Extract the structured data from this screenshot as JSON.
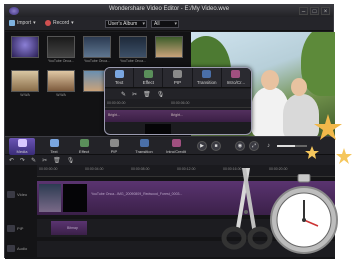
{
  "window": {
    "title": "Wondershare Video Editor - E:/My Video.wve"
  },
  "toolbar": {
    "import_label": "Import",
    "record_label": "Record",
    "album_select": "User's Album",
    "filter_select": "All"
  },
  "library": {
    "items": [
      {
        "label": ""
      },
      {
        "label": "YouTube Onca..."
      },
      {
        "label": "YouTube Onca..."
      },
      {
        "label": "YouTube Onca..."
      },
      {
        "label": ""
      },
      {
        "label": "W.WA"
      },
      {
        "label": "W.WA"
      },
      {
        "label": ""
      }
    ]
  },
  "popup": {
    "tabs": [
      {
        "label": "Text",
        "icon": "text-icon"
      },
      {
        "label": "Effect",
        "icon": "effect-icon"
      },
      {
        "label": "PIP",
        "icon": "pip-icon"
      },
      {
        "label": "Transition",
        "icon": "transition-icon"
      },
      {
        "label": "Intro/Cr...",
        "icon": "intro-credit-icon"
      }
    ],
    "ruler_times": [
      "00:00:00.00",
      "00:00:06.00"
    ],
    "clip_labels": [
      "Bright...",
      "Bright..."
    ]
  },
  "bottom_tabs": [
    {
      "label": "Media",
      "icon": "media-icon"
    },
    {
      "label": "Text",
      "icon": "text-icon"
    },
    {
      "label": "Effect",
      "icon": "effect-icon"
    },
    {
      "label": "PIP",
      "icon": "pip-icon"
    },
    {
      "label": "Transition",
      "icon": "transition-icon"
    },
    {
      "label": "Intro/Credit",
      "icon": "intro-credit-icon"
    }
  ],
  "timeline": {
    "ruler_times": [
      "00:00:00.00",
      "00:00:04.00",
      "00:00:08.00",
      "00:00:12.00",
      "00:00:16.00",
      "00:00:20.00"
    ],
    "rows": [
      {
        "label": "Video",
        "clip_text": "YouTube Onca...IMG_20090809_Redwood_Forest_0003..."
      },
      {
        "label": "PIP",
        "clip_text": "Bitmap"
      },
      {
        "label": "Audio",
        "clip_text": ""
      }
    ]
  },
  "colors": {
    "accent": "#6b54b5",
    "track": "#4a2a55",
    "background": "#1b1b1d"
  }
}
